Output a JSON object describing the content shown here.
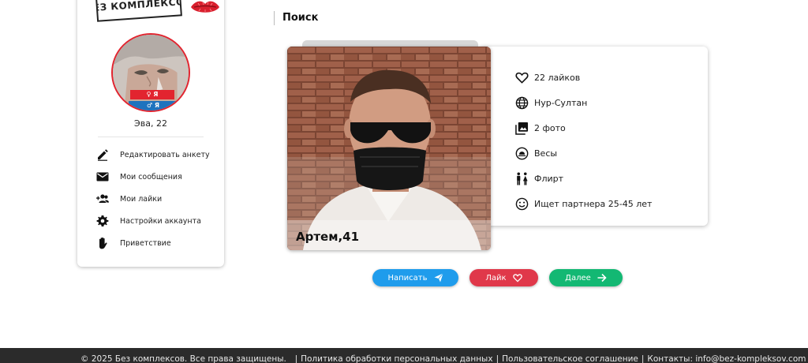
{
  "logo": {
    "text": "БЕЗ КОМПЛЕКСОВ"
  },
  "profile": {
    "badge_girl": "♀ Я ДЕВУШКА",
    "badge_boy": "♂ Я МУЖЧИНА",
    "name": "Эва, 22"
  },
  "sidebar": {
    "items": [
      {
        "label": "Редактировать анкету",
        "icon": "pencil-icon"
      },
      {
        "label": "Мои сообщения",
        "icon": "envelope-icon"
      },
      {
        "label": "Мои лайки",
        "icon": "group-add-icon"
      },
      {
        "label": "Настройки аккаунта",
        "icon": "gear-icon"
      },
      {
        "label": "Приветствие",
        "icon": "hand-icon"
      }
    ]
  },
  "header": {
    "title": "Поиск"
  },
  "candidate": {
    "name": "Артем,41",
    "info": [
      {
        "text": "22 лайков",
        "icon": "heart-icon"
      },
      {
        "text": "Нур-Султан",
        "icon": "globe-icon"
      },
      {
        "text": "2 фото",
        "icon": "photos-icon"
      },
      {
        "text": "Весы",
        "icon": "zodiac-icon"
      },
      {
        "text": "Флирт",
        "icon": "couple-icon"
      },
      {
        "text": "Ищет партнера 25-45 лет",
        "icon": "smile-icon"
      }
    ]
  },
  "actions": {
    "write": "Написать",
    "like": "Лайк",
    "next": "Далее"
  },
  "colors": {
    "write": "#1f9cec",
    "like": "#e0384a",
    "next": "#13b873",
    "accent": "#e2242f"
  },
  "footer": {
    "copyright": "© 2025 Без комплексов. Все права защищены.",
    "privacy": "Политика обработки персональных данных",
    "terms": "Пользовательское соглашение",
    "contacts": "Контакты: info@bez-kompleksov.com"
  }
}
